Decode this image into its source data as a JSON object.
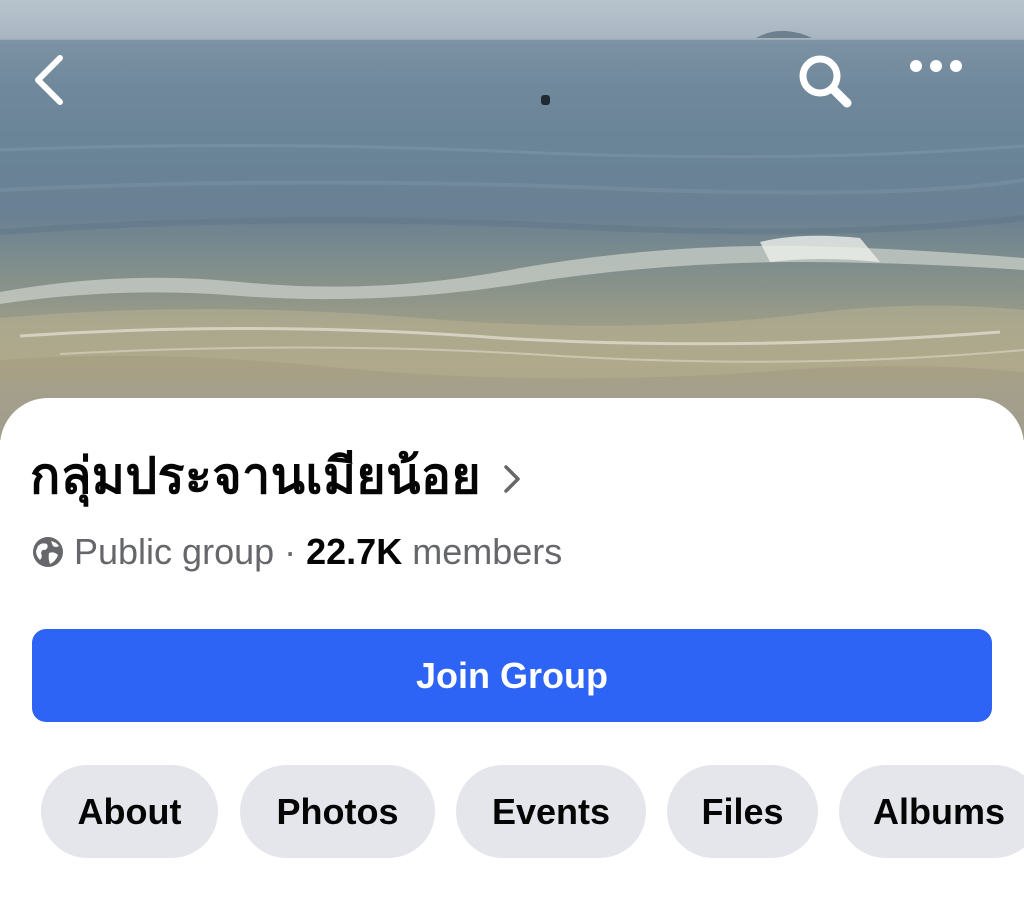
{
  "header": {
    "back_icon": "chevron-left-icon",
    "search_icon": "search-icon",
    "more_icon": "more-horizontal-icon"
  },
  "group": {
    "name": "กลุ่มประจานเมียน้อย",
    "privacy_icon": "globe-icon",
    "privacy": "Public group",
    "separator": "·",
    "member_count": "22.7K",
    "member_label": "members"
  },
  "actions": {
    "join_label": "Join Group",
    "join_color": "#2d64f5"
  },
  "tabs": [
    {
      "label": "About"
    },
    {
      "label": "Photos"
    },
    {
      "label": "Events"
    },
    {
      "label": "Files"
    },
    {
      "label": "Albums"
    }
  ],
  "colors": {
    "tab_background": "#e4e6eb",
    "secondary_text": "#65676b",
    "primary_text": "#050505"
  }
}
